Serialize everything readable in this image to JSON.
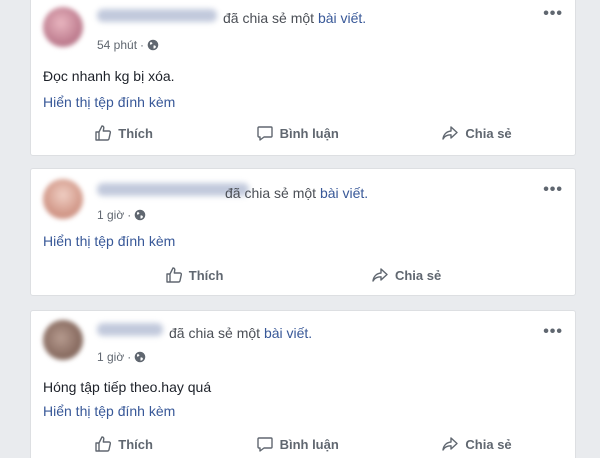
{
  "posts": [
    {
      "shared_text": "đã chia sẻ một",
      "shared_link": "bài viết.",
      "time": "54 phút",
      "dot": "·",
      "body": "Đọc nhanh kg bị xóa.",
      "attachment": "Hiển thị tệp đính kèm",
      "actions": {
        "like": "Thích",
        "comment": "Bình luận",
        "share": "Chia sẻ"
      }
    },
    {
      "shared_text": "đã chia sẻ một",
      "shared_link": "bài viết.",
      "time": "1 giờ",
      "dot": "·",
      "attachment": "Hiển thị tệp đính kèm",
      "actions": {
        "like": "Thích",
        "share": "Chia sẻ"
      }
    },
    {
      "shared_text": "đã chia sẻ một",
      "shared_link": "bài viết.",
      "time": "1 giờ",
      "dot": "·",
      "body": "Hóng tập tiếp theo.hay quá",
      "attachment": "Hiển thị tệp đính kèm",
      "actions": {
        "like": "Thích",
        "comment": "Bình luận",
        "share": "Chia sẻ"
      }
    }
  ],
  "more_glyph": "•••",
  "colors": {
    "link": "#385898",
    "secondary_text": "#606770",
    "page_background": "#e9ebee"
  },
  "icons": [
    "globe-icon",
    "thumbs-up-icon",
    "comment-icon",
    "share-icon",
    "more-options-icon"
  ]
}
